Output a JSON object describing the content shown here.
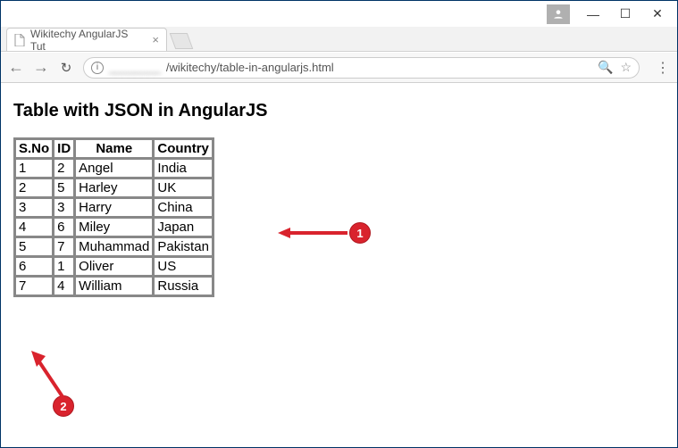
{
  "window": {
    "tab_title": "Wikitechy AngularJS Tut",
    "url_prefix_icon": "i",
    "url_blurred": "________",
    "url_visible": "/wikitechy/table-in-angularjs.html"
  },
  "page": {
    "heading": "Table with JSON in AngularJS",
    "columns": [
      "S.No",
      "ID",
      "Name",
      "Country"
    ],
    "rows": [
      {
        "sno": "1",
        "id": "2",
        "name": "Angel",
        "country": "India"
      },
      {
        "sno": "2",
        "id": "5",
        "name": "Harley",
        "country": "UK"
      },
      {
        "sno": "3",
        "id": "3",
        "name": "Harry",
        "country": "China"
      },
      {
        "sno": "4",
        "id": "6",
        "name": "Miley",
        "country": "Japan"
      },
      {
        "sno": "5",
        "id": "7",
        "name": "Muhammad",
        "country": "Pakistan"
      },
      {
        "sno": "6",
        "id": "1",
        "name": "Oliver",
        "country": "US"
      },
      {
        "sno": "7",
        "id": "4",
        "name": "William",
        "country": "Russia"
      }
    ]
  },
  "callouts": {
    "one": "1",
    "two": "2"
  }
}
